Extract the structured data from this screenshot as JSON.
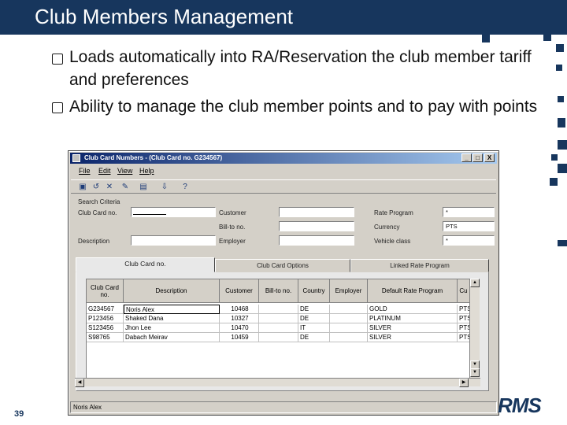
{
  "slide": {
    "title": "Club Members Management",
    "bullets": [
      "Loads automatically into RA/Reservation the club member tariff and preferences",
      "Ability to manage the club member points and to pay with points"
    ],
    "page_number": "39",
    "brand": "RMS",
    "accent_color": "#17365d"
  },
  "window": {
    "title": "Club Card Numbers - (Club Card no. G234567)",
    "controls": [
      "_",
      "□",
      "X"
    ],
    "menu": [
      "File",
      "Edit",
      "View",
      "Help"
    ],
    "toolbar_icons": [
      "save-icon",
      "undo-icon",
      "delete-icon",
      "tools-icon",
      "notes-icon",
      "export-icon",
      "help-icon"
    ],
    "search": {
      "group_label": "Search Criteria",
      "club_card_no": {
        "label": "Club Card no.",
        "value": ""
      },
      "description": {
        "label": "Description",
        "value": ""
      },
      "customer": {
        "label": "Customer",
        "value": ""
      },
      "bill_to_no": {
        "label": "Bill-to no.",
        "value": ""
      },
      "employer": {
        "label": "Employer",
        "value": ""
      },
      "rate_program": {
        "label": "Rate Program",
        "value": "*"
      },
      "currency": {
        "label": "Currency",
        "value": "PTS"
      },
      "vehicle_class": {
        "label": "Vehicle class",
        "value": "*"
      }
    },
    "tabs": [
      "Club Card no.",
      "Club Card Options",
      "Linked Rate Program"
    ],
    "grid": {
      "headers": [
        "Club Card no.",
        "Description",
        "Customer",
        "Bill-to no.",
        "Country",
        "Employer",
        "Default Rate Program",
        "Cu"
      ],
      "rows": [
        [
          "G234567",
          "Noris Alex",
          "10468",
          "",
          "DE",
          "",
          "GOLD",
          "PTS"
        ],
        [
          "P123456",
          "Shaked Dana",
          "10327",
          "",
          "DE",
          "",
          "PLATINUM",
          "PTS"
        ],
        [
          "S123456",
          "Jhon Lee",
          "10470",
          "",
          "IT",
          "",
          "SILVER",
          "PTS"
        ],
        [
          "S98765",
          "Dabach Meirav",
          "10459",
          "",
          "DE",
          "",
          "SILVER",
          "PTS"
        ]
      ]
    },
    "status": "Noris Alex"
  }
}
